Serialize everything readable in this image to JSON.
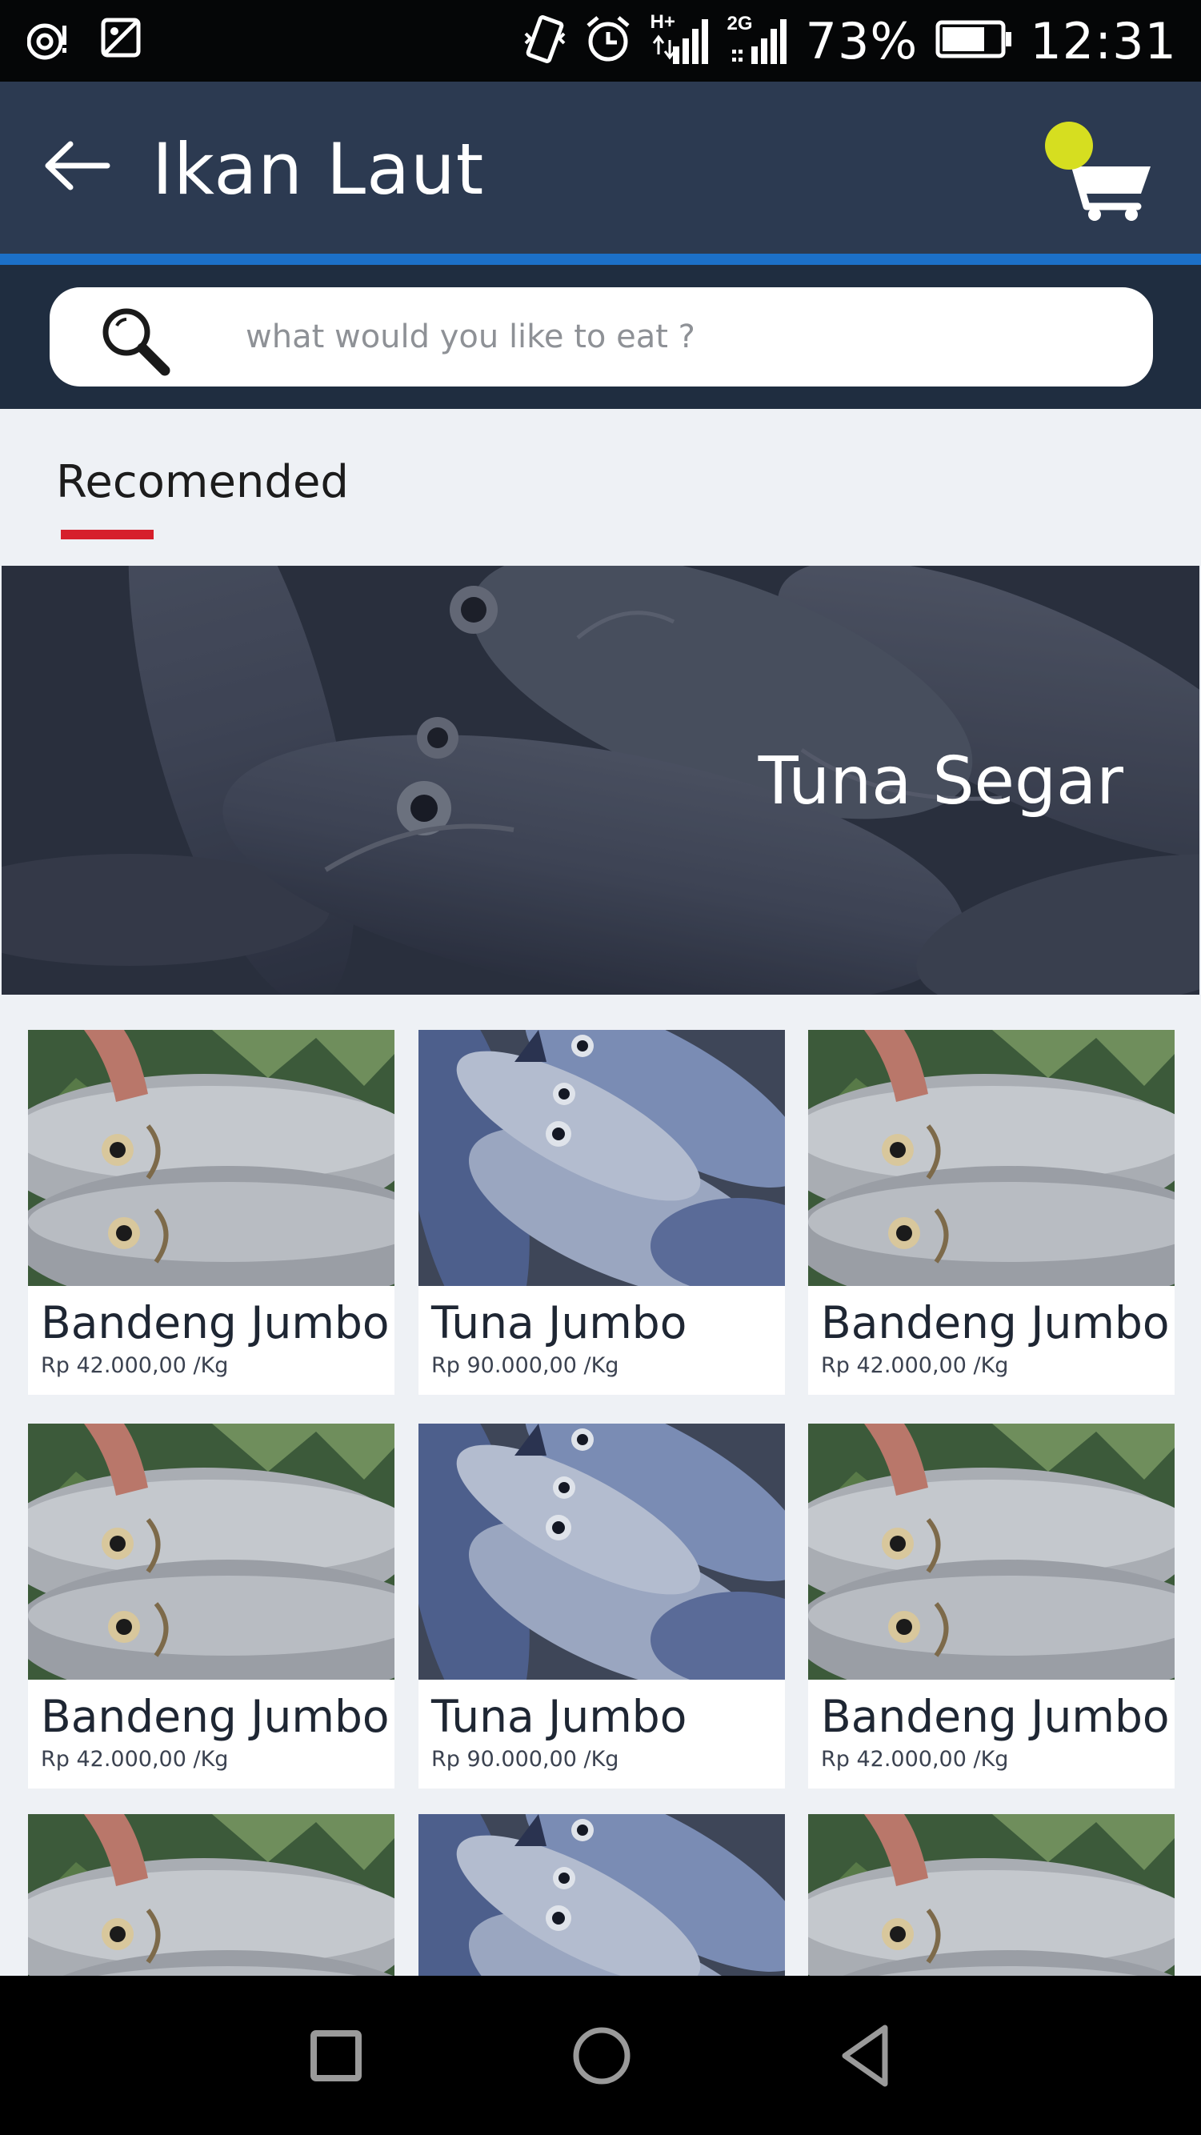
{
  "status_bar": {
    "battery_percent": "73%",
    "time": "12:31",
    "network_labels": [
      "H+",
      "2G"
    ],
    "icons": [
      "hotspot-icon",
      "image-icon",
      "vibrate-icon",
      "alarm-icon",
      "signal-icon",
      "signal-icon",
      "battery-icon"
    ]
  },
  "app_bar": {
    "title": "Ikan Laut",
    "back_icon": "arrow-left-icon",
    "cart_icon": "cart-icon",
    "cart_badge_color": "#d6de20"
  },
  "search": {
    "placeholder": "what would you like to eat ?"
  },
  "section": {
    "tab_label": "Recomended",
    "indicator_color": "#d61f2b"
  },
  "banner": {
    "title": "Tuna Segar"
  },
  "products": [
    {
      "name": "Bandeng Jumbo",
      "price": "Rp 42.000,00 /Kg",
      "kind": "bandeng"
    },
    {
      "name": "Tuna Jumbo",
      "price": "Rp 90.000,00 /Kg",
      "kind": "tuna"
    },
    {
      "name": "Bandeng Jumbo",
      "price": "Rp 42.000,00 /Kg",
      "kind": "bandeng"
    },
    {
      "name": "Bandeng Jumbo",
      "price": "Rp 42.000,00 /Kg",
      "kind": "bandeng"
    },
    {
      "name": "Tuna Jumbo",
      "price": "Rp 90.000,00 /Kg",
      "kind": "tuna"
    },
    {
      "name": "Bandeng Jumbo",
      "price": "Rp 42.000,00 /Kg",
      "kind": "bandeng"
    },
    {
      "name": "",
      "price": "",
      "kind": "bandeng"
    },
    {
      "name": "",
      "price": "",
      "kind": "tuna"
    },
    {
      "name": "",
      "price": "",
      "kind": "bandeng"
    }
  ],
  "nav_bar": {
    "buttons": [
      "recents-icon",
      "home-icon",
      "back-icon"
    ]
  },
  "colors": {
    "app_bar": "#2c3a51",
    "accent_line": "#1c70c8",
    "search_strip": "#1f2d40"
  }
}
